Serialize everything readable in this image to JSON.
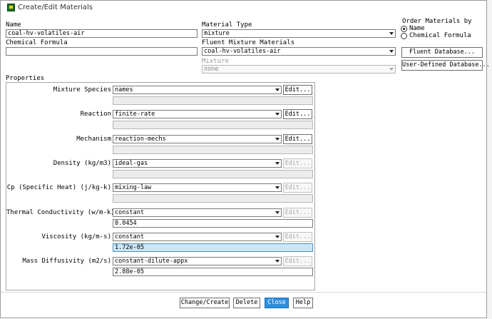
{
  "window": {
    "title": "Create/Edit Materials"
  },
  "name": {
    "label": "Name",
    "value": "coal-hv-volatiles-air"
  },
  "chemical_formula": {
    "label": "Chemical Formula",
    "value": ""
  },
  "material_type": {
    "label": "Material Type",
    "value": "mixture"
  },
  "fluent_mixture": {
    "label": "Fluent Mixture Materials",
    "value": "coal-hv-volatiles-air"
  },
  "mixture": {
    "label": "Mixture",
    "value": "none"
  },
  "order_by": {
    "label": "Order Materials by",
    "options": [
      "Name",
      "Chemical Formula"
    ],
    "selected": "Name"
  },
  "buttons": {
    "fluent_db": "Fluent Database...",
    "user_db": "User-Defined Database...",
    "change_create": "Change/Create",
    "delete": "Delete",
    "close": "Close",
    "help": "Help"
  },
  "properties": {
    "label": "Properties",
    "edit": "Edit...",
    "rows": [
      {
        "label": "Mixture Species",
        "method": "names",
        "value": "",
        "edit_enabled": true
      },
      {
        "label": "Reaction",
        "method": "finite-rate",
        "value": "",
        "edit_enabled": true
      },
      {
        "label": "Mechanism",
        "method": "reaction-mechs",
        "value": "",
        "edit_enabled": true
      },
      {
        "label": "Density (kg/m3)",
        "method": "ideal-gas",
        "value": "",
        "edit_enabled": false
      },
      {
        "label": "Cp (Specific Heat) (j/kg-k)",
        "method": "mixing-law",
        "value": "",
        "edit_enabled": false
      },
      {
        "label": "Thermal Conductivity (w/m-k)",
        "method": "constant",
        "value": "0.0454",
        "edit_enabled": false
      },
      {
        "label": "Viscosity (kg/m-s)",
        "method": "constant",
        "value": "1.72e-05",
        "edit_enabled": false
      },
      {
        "label": "Mass Diffusivity (m2/s)",
        "method": "constant-dilute-appx",
        "value": "2.88e-05",
        "edit_enabled": false
      }
    ]
  },
  "colors": {
    "accent": "#2c8fe0",
    "highlight": "#cde6f7"
  }
}
